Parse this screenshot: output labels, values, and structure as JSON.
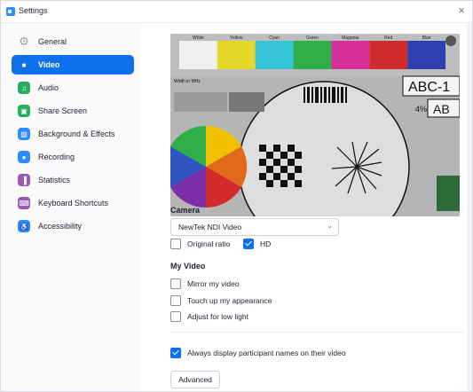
{
  "window": {
    "title": "Settings",
    "close_glyph": "×"
  },
  "sidebar": {
    "items": [
      {
        "label": "General",
        "icon": "gear-icon",
        "color": "#c8cdd4",
        "active": false
      },
      {
        "label": "Video",
        "icon": "video-camera-icon",
        "color": "#ffffff",
        "active": true
      },
      {
        "label": "Audio",
        "icon": "headphones-icon",
        "color": "#27ae60",
        "active": false
      },
      {
        "label": "Share Screen",
        "icon": "share-screen-icon",
        "color": "#27ae60",
        "active": false
      },
      {
        "label": "Background & Effects",
        "icon": "background-icon",
        "color": "#2d8cff",
        "active": false
      },
      {
        "label": "Recording",
        "icon": "record-icon",
        "color": "#2d8cff",
        "active": false
      },
      {
        "label": "Statistics",
        "icon": "statistics-icon",
        "color": "#9b59b6",
        "active": false
      },
      {
        "label": "Keyboard Shortcuts",
        "icon": "keyboard-icon",
        "color": "#9b59b6",
        "active": false
      },
      {
        "label": "Accessibility",
        "icon": "accessibility-icon",
        "color": "#2d8cff",
        "active": false
      }
    ]
  },
  "video": {
    "preview": {
      "bar_labels": [
        "White",
        "Yellow",
        "Cyan",
        "Green",
        "Magenta",
        "Red",
        "Blue"
      ],
      "bar_colors": [
        "#f0f0f0",
        "#e6d82a",
        "#35c5d6",
        "#2fae4a",
        "#d7309a",
        "#d12b2b",
        "#2e3fb0"
      ],
      "abc_label": "ABC-1",
      "abc_label_2": "AB",
      "pct_label": "4%",
      "small_text": "Width in MHz"
    },
    "camera": {
      "title": "Camera",
      "selected": "NewTek NDI Video",
      "original_ratio_label": "Original ratio",
      "original_ratio_checked": false,
      "hd_label": "HD",
      "hd_checked": true
    },
    "my_video": {
      "title": "My Video",
      "options": [
        {
          "label": "Mirror my video",
          "checked": false
        },
        {
          "label": "Touch up my appearance",
          "checked": false
        },
        {
          "label": "Adjust for low light",
          "checked": false
        }
      ]
    },
    "always_display_label": "Always display participant names on their video",
    "always_display_checked": true,
    "advanced_label": "Advanced"
  }
}
